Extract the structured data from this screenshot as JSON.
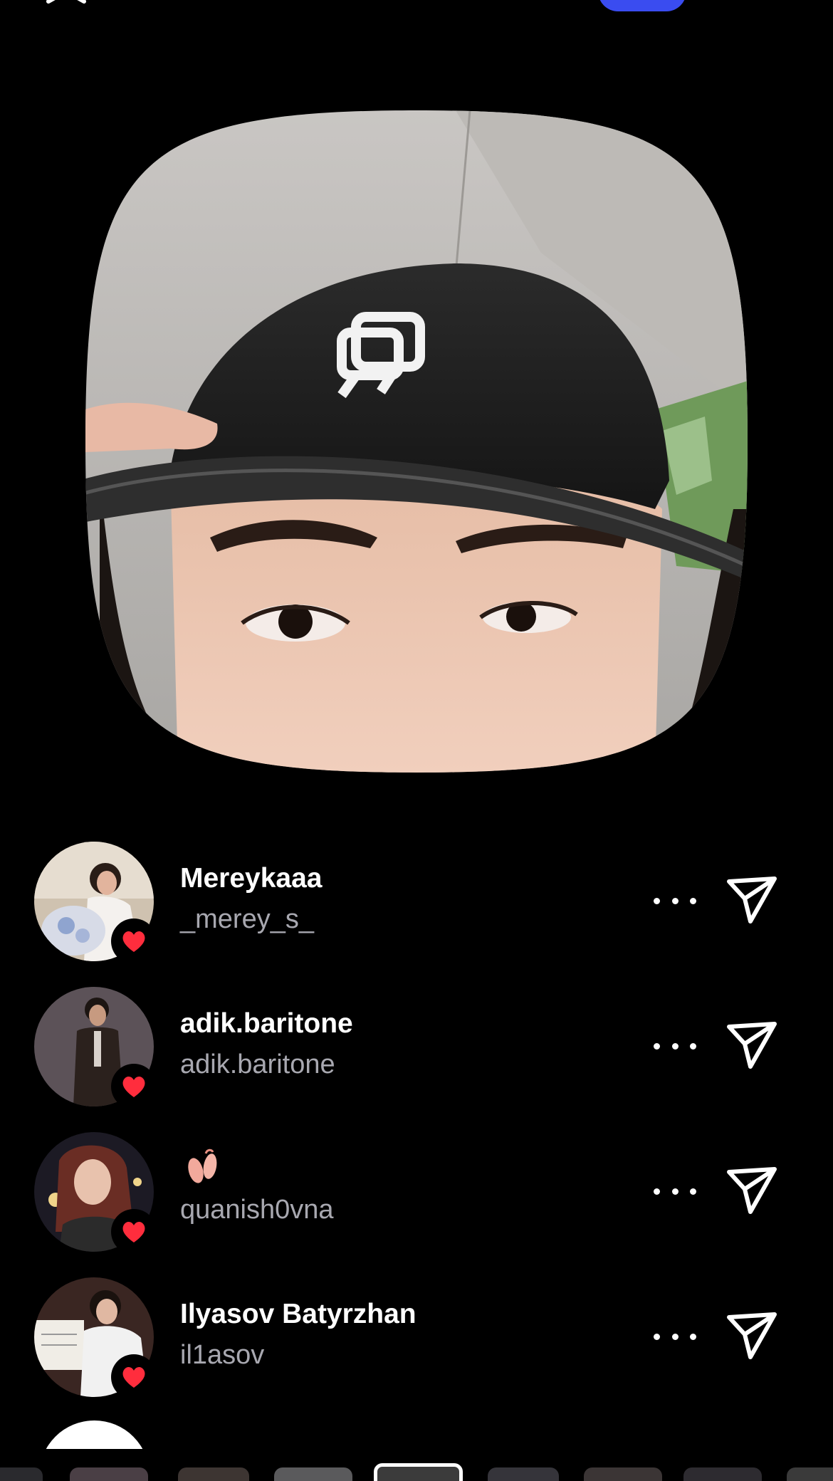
{
  "top_bar": {
    "close_icon": "close-icon",
    "accent_color": "#3a4cf0"
  },
  "photo": {
    "description_icon": "selfie-photo",
    "cap_logo_icon": "cap-logo-icon"
  },
  "list": {
    "items": [
      {
        "name": "Mereykaaa",
        "handle": "_merey_s_",
        "name_is_emoji": false,
        "reaction": "heart-icon"
      },
      {
        "name": "adik.baritone",
        "handle": "adik.baritone",
        "name_is_emoji": false,
        "reaction": "heart-icon"
      },
      {
        "name": "",
        "handle": "quanish0vna",
        "name_is_emoji": true,
        "emoji_icon": "ballet-shoes-icon",
        "reaction": "heart-icon"
      },
      {
        "name": "Ilyasov Batyrzhan",
        "handle": "il1asov",
        "name_is_emoji": false,
        "reaction": "heart-icon"
      }
    ]
  },
  "colors": {
    "background": "#000000",
    "handle_text": "#a8a8b0",
    "heart": "#ff2d3d"
  }
}
